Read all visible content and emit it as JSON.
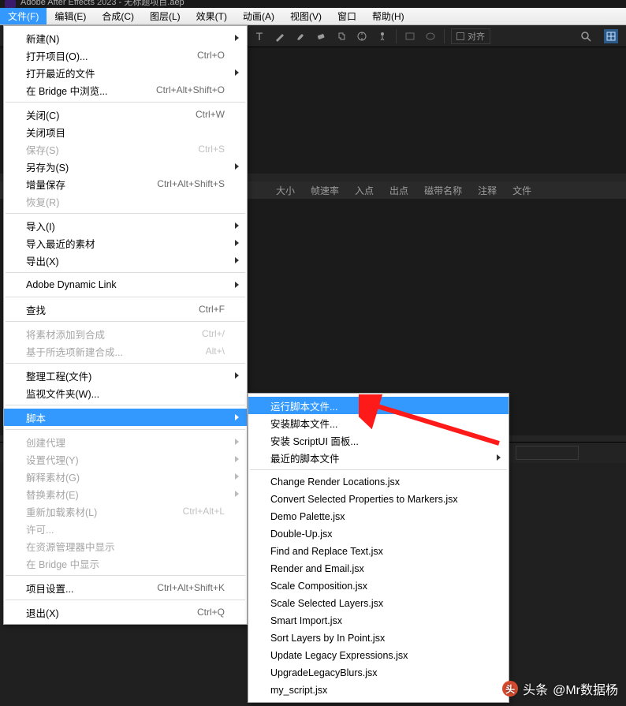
{
  "title": "Adobe After Effects 2023 - 无标题项目.aep",
  "menubar": [
    "文件(F)",
    "编辑(E)",
    "合成(C)",
    "图层(L)",
    "效果(T)",
    "动画(A)",
    "视图(V)",
    "窗口",
    "帮助(H)"
  ],
  "toolbar": {
    "align_label": "对齐"
  },
  "project_headers": [
    "大小",
    "帧速率",
    "入点",
    "出点",
    "磁带名称",
    "注释",
    "文件"
  ],
  "file_menu": [
    {
      "label": "新建(N)",
      "submenu": true
    },
    {
      "label": "打开项目(O)...",
      "accel": "Ctrl+O"
    },
    {
      "label": "打开最近的文件",
      "submenu": true
    },
    {
      "label": "在 Bridge 中浏览...",
      "accel": "Ctrl+Alt+Shift+O"
    },
    {
      "sep": true
    },
    {
      "label": "关闭(C)",
      "accel": "Ctrl+W"
    },
    {
      "label": "关闭项目"
    },
    {
      "label": "保存(S)",
      "accel": "Ctrl+S",
      "disabled": true
    },
    {
      "label": "另存为(S)",
      "submenu": true
    },
    {
      "label": "增量保存",
      "accel": "Ctrl+Alt+Shift+S"
    },
    {
      "label": "恢复(R)",
      "disabled": true
    },
    {
      "sep": true
    },
    {
      "label": "导入(I)",
      "submenu": true
    },
    {
      "label": "导入最近的素材",
      "submenu": true
    },
    {
      "label": "导出(X)",
      "submenu": true
    },
    {
      "sep": true
    },
    {
      "label": "Adobe Dynamic Link",
      "submenu": true
    },
    {
      "sep": true
    },
    {
      "label": "查找",
      "accel": "Ctrl+F"
    },
    {
      "sep": true
    },
    {
      "label": "将素材添加到合成",
      "accel": "Ctrl+/",
      "disabled": true
    },
    {
      "label": "基于所选项新建合成...",
      "accel": "Alt+\\",
      "disabled": true
    },
    {
      "sep": true
    },
    {
      "label": "整理工程(文件)",
      "submenu": true
    },
    {
      "label": "监视文件夹(W)..."
    },
    {
      "sep": true
    },
    {
      "label": "脚本",
      "submenu": true,
      "hover": true
    },
    {
      "sep": true
    },
    {
      "label": "创建代理",
      "submenu": true,
      "disabled": true
    },
    {
      "label": "设置代理(Y)",
      "submenu": true,
      "disabled": true
    },
    {
      "label": "解释素材(G)",
      "submenu": true,
      "disabled": true
    },
    {
      "label": "替换素材(E)",
      "submenu": true,
      "disabled": true
    },
    {
      "label": "重新加载素材(L)",
      "accel": "Ctrl+Alt+L",
      "disabled": true
    },
    {
      "label": "许可...",
      "disabled": true
    },
    {
      "label": "在资源管理器中显示",
      "disabled": true
    },
    {
      "label": "在 Bridge 中显示",
      "disabled": true
    },
    {
      "sep": true
    },
    {
      "label": "项目设置...",
      "accel": "Ctrl+Alt+Shift+K"
    },
    {
      "sep": true
    },
    {
      "label": "退出(X)",
      "accel": "Ctrl+Q"
    }
  ],
  "script_menu": [
    {
      "label": "运行脚本文件...",
      "hover": true
    },
    {
      "label": "安装脚本文件..."
    },
    {
      "label": "安装 ScriptUI 面板..."
    },
    {
      "label": "最近的脚本文件",
      "submenu": true
    },
    {
      "sep": true
    },
    {
      "label": "Change Render Locations.jsx"
    },
    {
      "label": "Convert Selected Properties to Markers.jsx"
    },
    {
      "label": "Demo Palette.jsx"
    },
    {
      "label": "Double-Up.jsx"
    },
    {
      "label": "Find and Replace Text.jsx"
    },
    {
      "label": "Render and Email.jsx"
    },
    {
      "label": "Scale Composition.jsx"
    },
    {
      "label": "Scale Selected Layers.jsx"
    },
    {
      "label": "Smart Import.jsx"
    },
    {
      "label": "Sort Layers by In Point.jsx"
    },
    {
      "label": "Update Legacy Expressions.jsx"
    },
    {
      "label": "UpgradeLegacyBlurs.jsx"
    },
    {
      "label": "my_script.jsx"
    }
  ],
  "watermark": {
    "prefix": "头条",
    "author": "@Mr数据杨"
  }
}
